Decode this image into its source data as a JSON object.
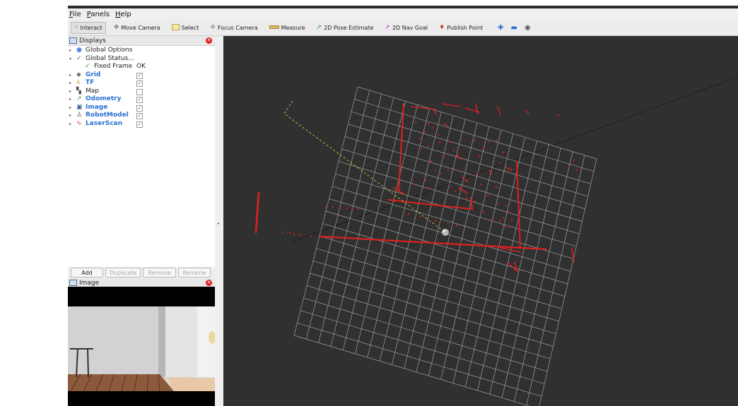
{
  "menu": {
    "file": {
      "u": "F",
      "rest": "ile"
    },
    "panels": {
      "u": "P",
      "rest": "anels"
    },
    "help": {
      "u": "H",
      "rest": "elp"
    }
  },
  "toolbar": {
    "interact": "Interact",
    "move_camera": "Move Camera",
    "select": "Select",
    "focus_camera": "Focus Camera",
    "measure": "Measure",
    "pose_estimate": "2D Pose Estimate",
    "nav_goal": "2D Nav Goal",
    "publish_point": "Publish Point"
  },
  "displays": {
    "title": "Displays",
    "items": [
      {
        "label": "Global Options",
        "arrow": "▸",
        "icon": "●",
        "icon_color": "#5b8ad8",
        "blue": false,
        "checked": null,
        "icon_name": "globe-icon"
      },
      {
        "label": "Global Status...",
        "arrow": "▾",
        "icon": "✓",
        "icon_color": "#2a8f2a",
        "blue": false,
        "checked": null,
        "icon_name": "check-icon"
      },
      {
        "label": "Fixed Frame",
        "status": "OK",
        "icon": "✓",
        "icon_color": "#2a8f2a",
        "blue": false,
        "checked": null,
        "child": true,
        "icon_name": "check-icon"
      },
      {
        "label": "Grid",
        "arrow": "▸",
        "icon": "◈",
        "icon_color": "#444",
        "blue": true,
        "checked": true,
        "icon_name": "grid-icon"
      },
      {
        "label": "TF",
        "arrow": "▸",
        "icon": "⅄",
        "icon_color": "#c88a2a",
        "blue": true,
        "checked": true,
        "icon_name": "tf-icon"
      },
      {
        "label": "Map",
        "arrow": "▸",
        "icon": "▚",
        "icon_color": "#555",
        "blue": false,
        "checked": false,
        "icon_name": "map-icon"
      },
      {
        "label": "Odometry",
        "arrow": "▸",
        "icon": "↗",
        "icon_color": "#2a9d2a",
        "blue": true,
        "checked": true,
        "icon_name": "odometry-icon"
      },
      {
        "label": "Image",
        "arrow": "▸",
        "icon": "▣",
        "icon_color": "#3a5fa0",
        "blue": true,
        "checked": true,
        "icon_name": "image-icon"
      },
      {
        "label": "RobotModel",
        "arrow": "▸",
        "icon": "♙",
        "icon_color": "#555",
        "blue": true,
        "checked": true,
        "icon_name": "robot-model-icon"
      },
      {
        "label": "LaserScan",
        "arrow": "▸",
        "icon": "∿",
        "icon_color": "#d22",
        "blue": true,
        "checked": true,
        "icon_name": "laserscan-icon"
      }
    ],
    "buttons": {
      "add": "Add",
      "duplicate": "Duplicate",
      "remove": "Remove",
      "rename": "Rename"
    }
  },
  "image_panel": {
    "title": "Image"
  },
  "colors": {
    "viewport_bg": "#303030",
    "grid": "#a0a0a0",
    "laser": "#e02020",
    "tf_path": "#b8c040",
    "accent_blue": "#2a6fd1"
  }
}
